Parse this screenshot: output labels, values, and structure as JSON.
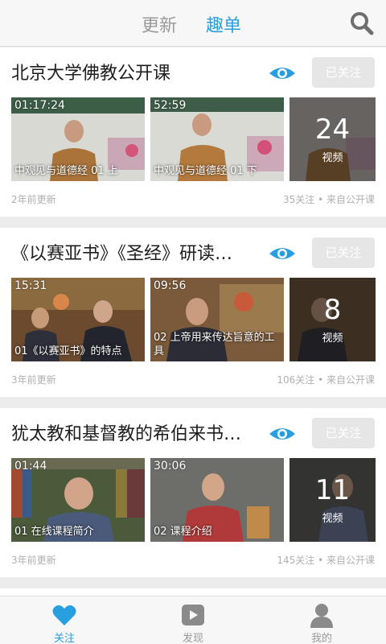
{
  "header": {
    "tabs": [
      {
        "label": "更新",
        "active": false
      },
      {
        "label": "趣单",
        "active": true
      }
    ],
    "accent_color": "#2a9fe0"
  },
  "follow_label": "已关注",
  "more_label": "视频",
  "cards": [
    {
      "title": "北京大学佛教公开课",
      "videos": [
        {
          "duration": "01:17:24",
          "title": "中观见与道德经 01 上"
        },
        {
          "duration": "52:59",
          "title": "中观见与道德经 01 下"
        }
      ],
      "more_count": "24",
      "updated": "2年前更新",
      "stats": "35关注 • 来自公开课"
    },
    {
      "title": "《以赛亚书》《圣经》研读…",
      "videos": [
        {
          "duration": "15:31",
          "title": "01《以赛亚书》的特点"
        },
        {
          "duration": "09:56",
          "title": "02 上帝用来传达旨意的工具"
        }
      ],
      "more_count": "8",
      "updated": "3年前更新",
      "stats": "106关注 • 来自公开课"
    },
    {
      "title": "犹太教和基督教的希伯来书…",
      "videos": [
        {
          "duration": "01:44",
          "title": "01 在线课程简介"
        },
        {
          "duration": "30:06",
          "title": "02 课程介绍"
        }
      ],
      "more_count": "11",
      "updated": "3年前更新",
      "stats": "145关注 • 来自公开课"
    }
  ],
  "bottom_nav": [
    {
      "label": "关注",
      "icon": "heart-icon",
      "active": true
    },
    {
      "label": "发现",
      "icon": "play-icon",
      "active": false
    },
    {
      "label": "我的",
      "icon": "person-icon",
      "active": false
    }
  ]
}
